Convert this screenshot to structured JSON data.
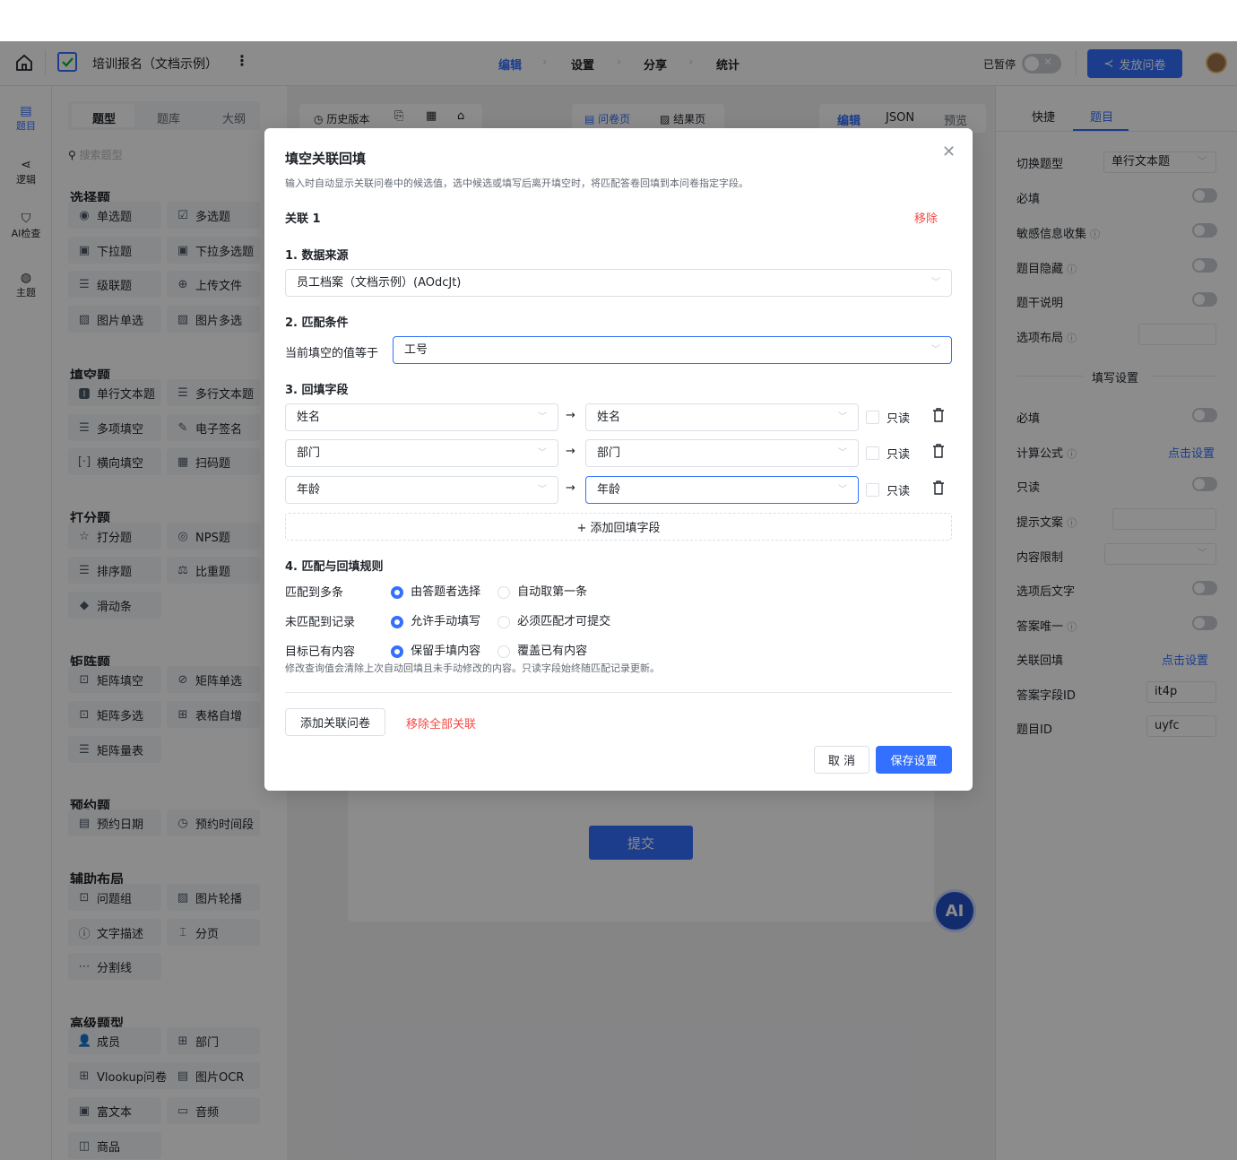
{
  "header": {
    "title": "培训报名（文档示例）",
    "steps": [
      "编辑",
      "设置",
      "分享",
      "统计"
    ],
    "paused": "已暂停",
    "publish": "发放问卷"
  },
  "lefticons": [
    {
      "icon": "document-icon",
      "label": "题目"
    },
    {
      "icon": "branch-icon",
      "label": "逻辑"
    },
    {
      "icon": "shield-check-icon",
      "label": "AI检查"
    },
    {
      "icon": "palette-icon",
      "label": "主题"
    }
  ],
  "sidebar": {
    "tabs": [
      "题型",
      "题库",
      "大纲"
    ],
    "search_placeholder": "搜索题型",
    "sections": [
      {
        "title": "选择题",
        "items": [
          "单选题",
          "多选题",
          "下拉题",
          "下拉多选题",
          "级联题",
          "上传文件",
          "图片单选",
          "图片多选"
        ]
      },
      {
        "title": "填空题",
        "items": [
          "单行文本题",
          "多行文本题",
          "多项填空",
          "电子签名",
          "横向填空",
          "扫码题"
        ]
      },
      {
        "title": "打分题",
        "items": [
          "打分题",
          "NPS题",
          "排序题",
          "比重题",
          "滑动条"
        ]
      },
      {
        "title": "矩阵题",
        "items": [
          "矩阵填空",
          "矩阵单选",
          "矩阵多选",
          "表格自增",
          "矩阵量表"
        ]
      },
      {
        "title": "预约题",
        "items": [
          "预约日期",
          "预约时间段"
        ]
      },
      {
        "title": "辅助布局",
        "items": [
          "问题组",
          "图片轮播",
          "文字描述",
          "分页",
          "分割线"
        ]
      },
      {
        "title": "高级题型",
        "items": [
          "成员",
          "部门",
          "Vlookup问卷关联",
          "图片OCR",
          "富文本",
          "音频",
          "商品"
        ]
      }
    ]
  },
  "canvas": {
    "history": "历史版本",
    "page_tabs": [
      "问卷页",
      "结果页"
    ],
    "mode_tabs": [
      "编辑",
      "JSON",
      "预览"
    ],
    "submit": "提交"
  },
  "right": {
    "tabs": [
      "快捷",
      "题目"
    ],
    "switch_type_label": "切换题型",
    "switch_type_value": "单行文本题",
    "rows1": [
      "必填",
      "敏感信息收集",
      "题目隐藏",
      "题干说明",
      "选项布局"
    ],
    "fill_settings": "填写设置",
    "rows2": [
      "必填",
      "计算公式",
      "只读",
      "提示文案",
      "内容限制",
      "选项后文字",
      "答案唯一",
      "关联回填",
      "答案字段ID",
      "题目ID"
    ],
    "click_set": "点击设置",
    "field_id": "it4p",
    "question_id": "uyfc"
  },
  "modal": {
    "title": "填空关联回填",
    "desc": "输入时自动显示关联问卷中的候选值，选中候选或填写后离开填空时，将匹配答卷回填到本问卷指定字段。",
    "assoc": "关联 1",
    "remove": "移除",
    "s1": "1. 数据来源",
    "source": "员工档案（文档示例）(AOdcJt)",
    "s2": "2. 匹配条件",
    "cond_label": "当前填空的值等于",
    "cond_value": "工号",
    "s3": "3. 回填字段",
    "fields": [
      {
        "from": "姓名",
        "to": "姓名"
      },
      {
        "from": "部门",
        "to": "部门"
      },
      {
        "from": "年龄",
        "to": "年龄"
      }
    ],
    "readonly": "只读",
    "arrow": "→",
    "add_field": "+ 添加回填字段",
    "s4": "4. 匹配与回填规则",
    "rules": [
      {
        "label": "匹配到多条",
        "opt1": "由答题者选择",
        "opt2": "自动取第一条"
      },
      {
        "label": "未匹配到记录",
        "opt1": "允许手动填写",
        "opt2": "必须匹配才可提交"
      },
      {
        "label": "目标已有内容",
        "opt1": "保留手填内容",
        "opt2": "覆盖已有内容"
      }
    ],
    "note": "修改查询值会清除上次自动回填且未手动修改的内容。只读字段始终随匹配记录更新。",
    "add_assoc": "添加关联问卷",
    "remove_all": "移除全部关联",
    "cancel": "取 消",
    "save": "保存设置"
  },
  "colors": {
    "primary": "#3370ff",
    "danger": "#f54a45"
  }
}
